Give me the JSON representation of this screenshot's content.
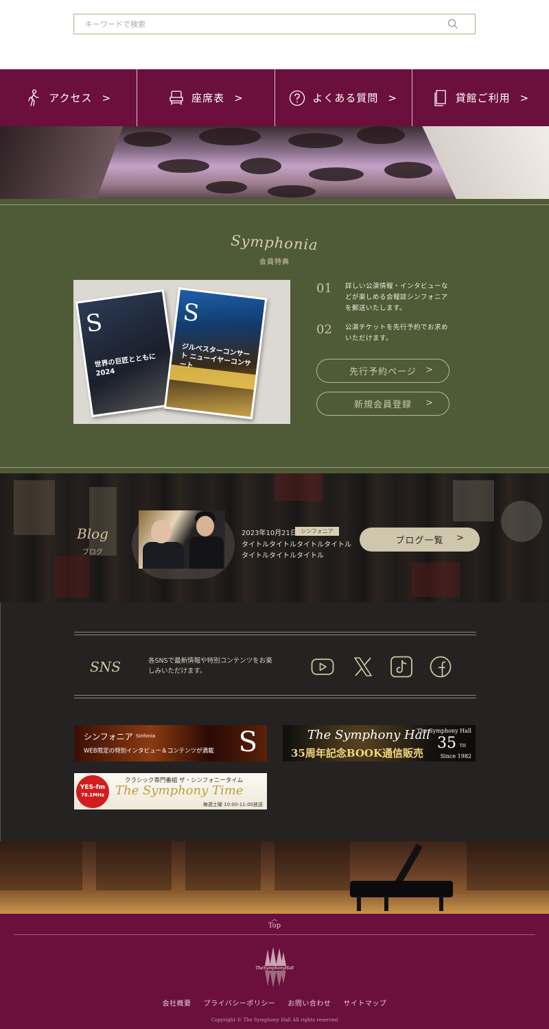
{
  "search": {
    "placeholder": "キーワードで検索"
  },
  "nav": {
    "items": [
      {
        "label": "アクセス",
        "arrow": ">"
      },
      {
        "label": "座席表",
        "arrow": ">"
      },
      {
        "label": "よくある質問",
        "arrow": ">"
      },
      {
        "label": "貸館ご利用",
        "arrow": ">"
      }
    ]
  },
  "symphonia": {
    "title": "Symphonia",
    "subtitle": "会員特典",
    "features": [
      {
        "num": "01",
        "text": "詳しい公演情報・インタビューなどが楽しめる会報誌シンフォニアを郵送いたします。"
      },
      {
        "num": "02",
        "text": "公演チケットを先行予約でお求めいただけます。"
      }
    ],
    "buttons": [
      {
        "label": "先行予約ページ",
        "arrow": ">"
      },
      {
        "label": "新規会員登録",
        "arrow": ">"
      }
    ],
    "magazine1_text": "世界の巨匠とともに 2024",
    "magazine2_text": "ジルベスターコンサート ニューイヤーコンサート"
  },
  "blog": {
    "title": "Blog",
    "subtitle": "ブログ",
    "post": {
      "date": "2023年10月21日",
      "tag": "シンフォニア",
      "title_line1": "タイトルタイトルタイトルタイトル",
      "title_line2": "タイトルタイトルタイトル"
    },
    "button": {
      "label": "ブログ一覧",
      "arrow": ">"
    }
  },
  "sns": {
    "title": "SNS",
    "text": "各SNSで最新情報や特別コンテンツをお楽しみいただけます。",
    "icons": [
      "youtube-icon",
      "x-icon",
      "tiktok-icon",
      "facebook-icon"
    ]
  },
  "banners": {
    "sinfonia": {
      "title": "シンフォニア",
      "title_sub": "Sinfonia",
      "text": "WEB限定の特別インタビュー＆コンテンツが満載",
      "letter": "S"
    },
    "book": {
      "title": "The Symphony Hall",
      "text": "35周年記念BOOK通信販売",
      "brand": "The Symphony Hall",
      "num": "35",
      "th": "TH",
      "since": "Since 1982"
    },
    "radio": {
      "logo_top": "YES-fm",
      "logo_bottom": "78.1MHz",
      "title": "クラシック専門番組 ザ・シンフォニータイム",
      "script": "The Symphony Time",
      "time": "毎週土曜 10:00-11:00放送"
    }
  },
  "footer": {
    "top": "Top",
    "links": [
      "会社概要",
      "プライバシーポリシー",
      "お問い合わせ",
      "サイトマップ"
    ],
    "copyright": "Copyright © The Symphony Hall All rights reserved",
    "logo_text": "TheSymphonyHall"
  },
  "colors": {
    "burgundy": "#6b0f3c",
    "olive": "#4e5b36",
    "gold": "#cfc5a0",
    "dark": "#242321"
  }
}
